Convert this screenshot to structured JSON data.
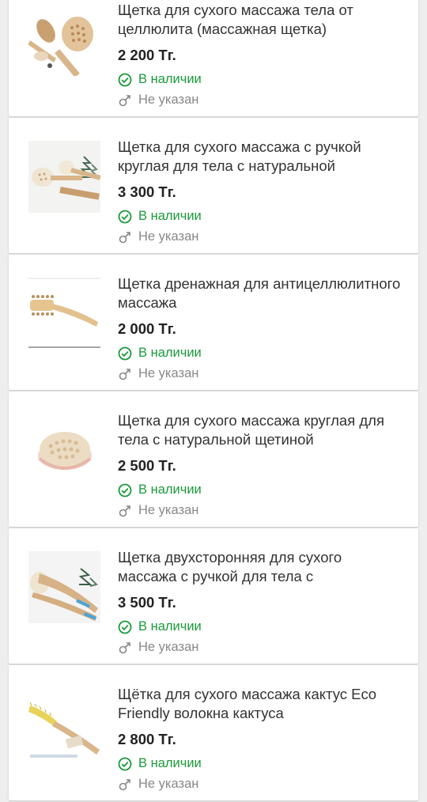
{
  "products": [
    {
      "title": "Щетка для сухого массажа тела от целлюлита (массажная щетка)",
      "price": "2 200 Тг.",
      "availability": "В наличии",
      "gender": "Не указан",
      "thumb": "double-brush-set"
    },
    {
      "title": "Щетка для сухого массажа с ручкой круглая для тела с натуральной",
      "price": "3 300 Тг.",
      "availability": "В наличии",
      "gender": "Не указан",
      "thumb": "round-brushes-with-pine"
    },
    {
      "title": "Щетка дренажная для антицеллюлитного массажа",
      "price": "2 000 Тг.",
      "availability": "В наличии",
      "gender": "Не указан",
      "thumb": "drainage-brush"
    },
    {
      "title": "Щетка для сухого массажа круглая для тела с натуральной щетиной",
      "price": "2 500 Тг.",
      "availability": "В наличии",
      "gender": "Не указан",
      "thumb": "round-palm-brush"
    },
    {
      "title": "Щетка двухсторонняя для сухого массажа с ручкой для тела с",
      "price": "3 500 Тг.",
      "availability": "В наличии",
      "gender": "Не указан",
      "thumb": "two-sided-brush"
    },
    {
      "title": "Щётка для сухого массажа кактус Eco Friendly волокна кактуса",
      "price": "2 800 Тг.",
      "availability": "В наличии",
      "gender": "Не указан",
      "thumb": "cactus-brush"
    }
  ],
  "colors": {
    "in_stock": "#1a9a3a",
    "muted": "#888888",
    "wood": "#d9b58a"
  }
}
